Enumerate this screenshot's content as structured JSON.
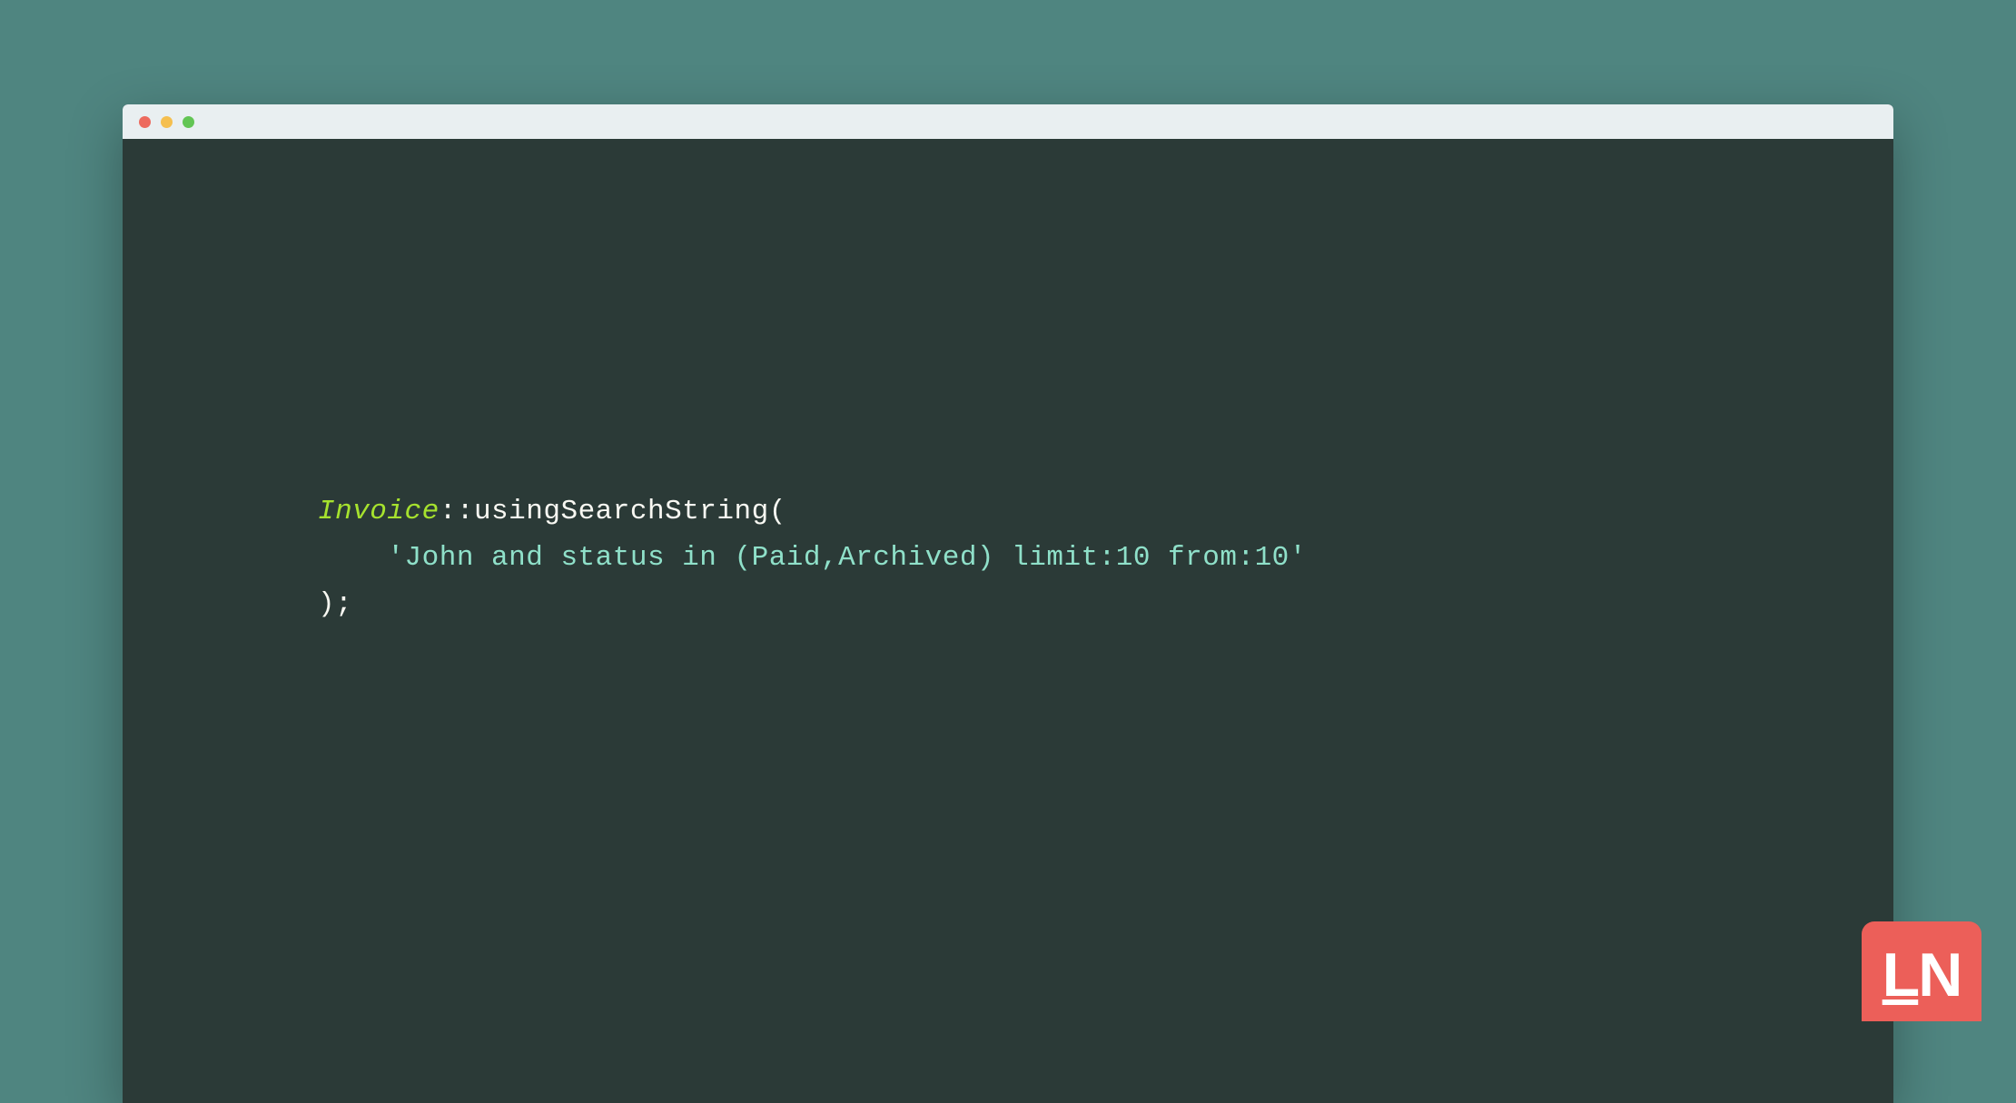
{
  "code": {
    "line1": {
      "class": "Invoice",
      "scope": "::",
      "method": "usingSearchString",
      "open": "("
    },
    "line2": {
      "indent": "    ",
      "string": "'John and status in (Paid,Archived) limit:10 from:10'"
    },
    "line3": {
      "close": ");"
    }
  },
  "logo": {
    "text": "LN"
  },
  "colors": {
    "background": "#4f8580",
    "editor_bg": "#2b3a37",
    "titlebar_bg": "#e9eff1",
    "traffic_red": "#ed6a5e",
    "traffic_yellow": "#f5bf4f",
    "traffic_green": "#62c554",
    "token_class": "#a6e22e",
    "token_default": "#f8f8f2",
    "token_string": "#8fe0c9",
    "logo_bg": "#ec5f59",
    "logo_fg": "#ffffff"
  }
}
